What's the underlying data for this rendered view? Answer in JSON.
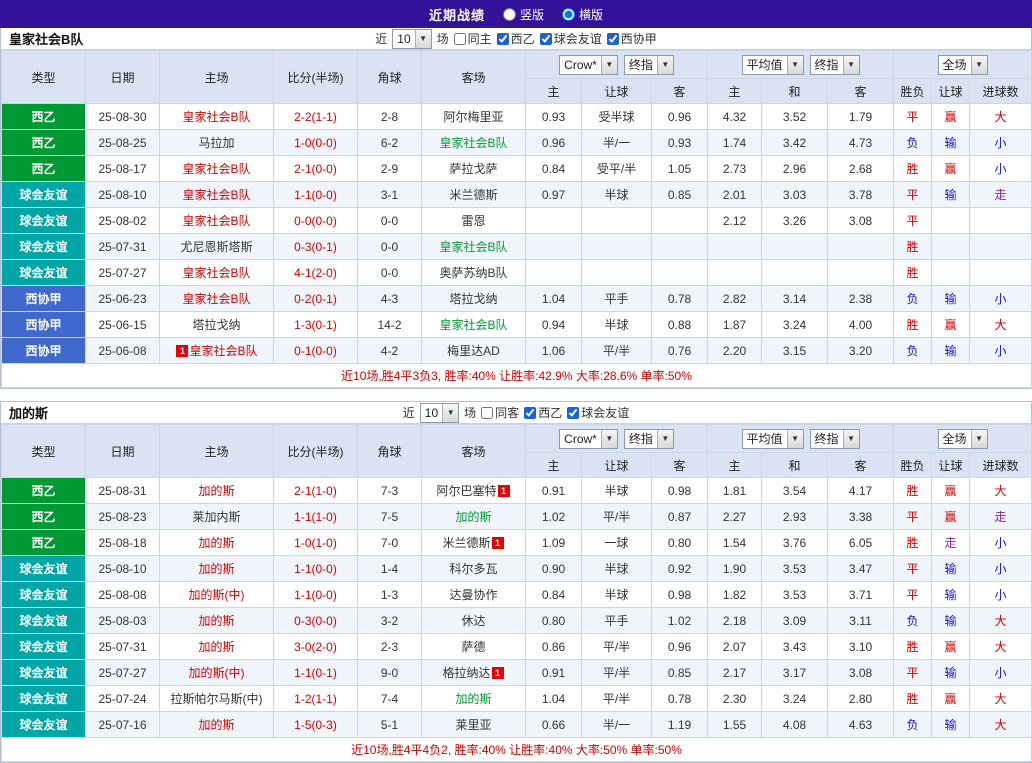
{
  "topbar": {
    "title": "近期战绩",
    "radio_vertical": "竖版",
    "radio_horizontal": "横版",
    "selected": "横版"
  },
  "colors": {
    "topbar_bg": "#341199",
    "header_bg": "#d9e3f3",
    "liga2_green": "#009933",
    "friendly_teal": "#00a6a6",
    "federation_blue": "#4169cd",
    "win_red": "#d40000",
    "lose_blue": "#1515cc",
    "push_purple": "#8822bb",
    "summary_red": "#d10000"
  },
  "table_headers": {
    "type": "类型",
    "date": "日期",
    "home": "主场",
    "score": "比分(半场)",
    "corner": "角球",
    "away": "客场",
    "asian_sub": [
      "主",
      "让球",
      "客"
    ],
    "euro_sub": [
      "主",
      "和",
      "客"
    ],
    "result_sub": [
      "胜负",
      "让球",
      "进球数"
    ]
  },
  "tables": [
    {
      "team": "皇家社会B队",
      "filters": {
        "near": "近",
        "count": "10",
        "games": "场",
        "checkboxes": [
          {
            "label": "同主",
            "checked": false
          },
          {
            "label": "西乙",
            "checked": true
          },
          {
            "label": "球会友谊",
            "checked": true
          },
          {
            "label": "西协甲",
            "checked": true
          }
        ]
      },
      "dropdowns": {
        "company": "Crow*",
        "company_stage": "终指",
        "euro": "平均值",
        "euro_stage": "终指",
        "scope": "全场"
      },
      "rows": [
        {
          "league": "西乙",
          "league_type": "liga2",
          "date": "25-08-30",
          "home": {
            "name": "皇家社会B队",
            "color": "red"
          },
          "score": "2-2(1-1)",
          "corner": "2-8",
          "away": {
            "name": "阿尔梅里亚",
            "color": "black"
          },
          "odds": [
            "0.93",
            "受半球",
            "0.96"
          ],
          "euro": [
            "4.32",
            "3.52",
            "1.79"
          ],
          "res": [
            [
              "平",
              "red"
            ],
            [
              "赢",
              "red"
            ],
            [
              "大",
              "red"
            ]
          ]
        },
        {
          "league": "西乙",
          "league_type": "liga2",
          "date": "25-08-25",
          "home": {
            "name": "马拉加",
            "color": "black"
          },
          "score": "1-0(0-0)",
          "corner": "6-2",
          "away": {
            "name": "皇家社会B队",
            "color": "green"
          },
          "odds": [
            "0.96",
            "半/一",
            "0.93"
          ],
          "euro": [
            "1.74",
            "3.42",
            "4.73"
          ],
          "res": [
            [
              "负",
              "blue"
            ],
            [
              "输",
              "blue"
            ],
            [
              "小",
              "blue"
            ]
          ]
        },
        {
          "league": "西乙",
          "league_type": "liga2",
          "date": "25-08-17",
          "home": {
            "name": "皇家社会B队",
            "color": "red"
          },
          "score": "2-1(0-0)",
          "corner": "2-9",
          "away": {
            "name": "萨拉戈萨",
            "color": "black"
          },
          "odds": [
            "0.84",
            "受平/半",
            "1.05"
          ],
          "euro": [
            "2.73",
            "2.96",
            "2.68"
          ],
          "res": [
            [
              "胜",
              "red"
            ],
            [
              "赢",
              "red"
            ],
            [
              "小",
              "blue"
            ]
          ]
        },
        {
          "league": "球会友谊",
          "league_type": "friendly",
          "date": "25-08-10",
          "home": {
            "name": "皇家社会B队",
            "color": "red"
          },
          "score": "1-1(0-0)",
          "corner": "3-1",
          "away": {
            "name": "米兰德斯",
            "color": "black"
          },
          "odds": [
            "0.97",
            "半球",
            "0.85"
          ],
          "euro": [
            "2.01",
            "3.03",
            "3.78"
          ],
          "res": [
            [
              "平",
              "red"
            ],
            [
              "输",
              "blue"
            ],
            [
              "走",
              "purple"
            ]
          ]
        },
        {
          "league": "球会友谊",
          "league_type": "friendly",
          "date": "25-08-02",
          "home": {
            "name": "皇家社会B队",
            "color": "red"
          },
          "score": "0-0(0-0)",
          "corner": "0-0",
          "away": {
            "name": "雷恩",
            "color": "black"
          },
          "odds": [
            "",
            "",
            ""
          ],
          "euro": [
            "2.12",
            "3.26",
            "3.08"
          ],
          "res": [
            [
              "平",
              "red"
            ],
            [
              "",
              ""
            ],
            [
              "",
              ""
            ]
          ]
        },
        {
          "league": "球会友谊",
          "league_type": "friendly",
          "date": "25-07-31",
          "home": {
            "name": "尤尼恩斯塔斯",
            "color": "black"
          },
          "score": "0-3(0-1)",
          "corner": "0-0",
          "away": {
            "name": "皇家社会B队",
            "color": "green"
          },
          "odds": [
            "",
            "",
            ""
          ],
          "euro": [
            "",
            "",
            ""
          ],
          "res": [
            [
              "胜",
              "red"
            ],
            [
              "",
              ""
            ],
            [
              "",
              ""
            ]
          ]
        },
        {
          "league": "球会友谊",
          "league_type": "friendly",
          "date": "25-07-27",
          "home": {
            "name": "皇家社会B队",
            "color": "red"
          },
          "score": "4-1(2-0)",
          "corner": "0-0",
          "away": {
            "name": "奥萨苏纳B队",
            "color": "black"
          },
          "odds": [
            "",
            "",
            ""
          ],
          "euro": [
            "",
            "",
            ""
          ],
          "res": [
            [
              "胜",
              "red"
            ],
            [
              "",
              ""
            ],
            [
              "",
              ""
            ]
          ]
        },
        {
          "league": "西协甲",
          "league_type": "fed",
          "date": "25-06-23",
          "home": {
            "name": "皇家社会B队",
            "color": "red"
          },
          "score": "0-2(0-1)",
          "corner": "4-3",
          "away": {
            "name": "塔拉戈纳",
            "color": "black"
          },
          "odds": [
            "1.04",
            "平手",
            "0.78"
          ],
          "euro": [
            "2.82",
            "3.14",
            "2.38"
          ],
          "res": [
            [
              "负",
              "blue"
            ],
            [
              "输",
              "blue"
            ],
            [
              "小",
              "blue"
            ]
          ]
        },
        {
          "league": "西协甲",
          "league_type": "fed",
          "date": "25-06-15",
          "home": {
            "name": "塔拉戈纳",
            "color": "black"
          },
          "score": "1-3(0-1)",
          "corner": "14-2",
          "away": {
            "name": "皇家社会B队",
            "color": "green"
          },
          "odds": [
            "0.94",
            "半球",
            "0.88"
          ],
          "euro": [
            "1.87",
            "3.24",
            "4.00"
          ],
          "res": [
            [
              "胜",
              "red"
            ],
            [
              "赢",
              "red"
            ],
            [
              "大",
              "red"
            ]
          ]
        },
        {
          "league": "西协甲",
          "league_type": "fed",
          "date": "25-06-08",
          "home": {
            "name": "皇家社会B队",
            "color": "red",
            "badge": "1",
            "badge_pos": "before"
          },
          "score": "0-1(0-0)",
          "corner": "4-2",
          "away": {
            "name": "梅里达AD",
            "color": "black"
          },
          "odds": [
            "1.06",
            "平/半",
            "0.76"
          ],
          "euro": [
            "2.20",
            "3.15",
            "3.20"
          ],
          "res": [
            [
              "负",
              "blue"
            ],
            [
              "输",
              "blue"
            ],
            [
              "小",
              "blue"
            ]
          ]
        }
      ],
      "summary": "近10场,胜4平3负3, 胜率:40% 让胜率:42.9% 大率:28.6% 单率:50%"
    },
    {
      "team": "加的斯",
      "filters": {
        "near": "近",
        "count": "10",
        "games": "场",
        "checkboxes": [
          {
            "label": "同客",
            "checked": false
          },
          {
            "label": "西乙",
            "checked": true
          },
          {
            "label": "球会友谊",
            "checked": true
          }
        ]
      },
      "dropdowns": {
        "company": "Crow*",
        "company_stage": "终指",
        "euro": "平均值",
        "euro_stage": "终指",
        "scope": "全场"
      },
      "rows": [
        {
          "league": "西乙",
          "league_type": "liga2",
          "date": "25-08-31",
          "home": {
            "name": "加的斯",
            "color": "red"
          },
          "score": "2-1(1-0)",
          "corner": "7-3",
          "away": {
            "name": "阿尔巴塞特",
            "color": "black",
            "badge": "1",
            "badge_pos": "after"
          },
          "odds": [
            "0.91",
            "半球",
            "0.98"
          ],
          "euro": [
            "1.81",
            "3.54",
            "4.17"
          ],
          "res": [
            [
              "胜",
              "red"
            ],
            [
              "赢",
              "red"
            ],
            [
              "大",
              "red"
            ]
          ]
        },
        {
          "league": "西乙",
          "league_type": "liga2",
          "date": "25-08-23",
          "home": {
            "name": "莱加内斯",
            "color": "black"
          },
          "score": "1-1(1-0)",
          "corner": "7-5",
          "away": {
            "name": "加的斯",
            "color": "green"
          },
          "odds": [
            "1.02",
            "平/半",
            "0.87"
          ],
          "euro": [
            "2.27",
            "2.93",
            "3.38"
          ],
          "res": [
            [
              "平",
              "red"
            ],
            [
              "赢",
              "red"
            ],
            [
              "走",
              "purple"
            ]
          ]
        },
        {
          "league": "西乙",
          "league_type": "liga2",
          "date": "25-08-18",
          "home": {
            "name": "加的斯",
            "color": "red"
          },
          "score": "1-0(1-0)",
          "corner": "7-0",
          "away": {
            "name": "米兰德斯",
            "color": "black",
            "badge": "1",
            "badge_pos": "after"
          },
          "odds": [
            "1.09",
            "一球",
            "0.80"
          ],
          "euro": [
            "1.54",
            "3.76",
            "6.05"
          ],
          "res": [
            [
              "胜",
              "red"
            ],
            [
              "走",
              "purple"
            ],
            [
              "小",
              "blue"
            ]
          ]
        },
        {
          "league": "球会友谊",
          "league_type": "friendly",
          "date": "25-08-10",
          "home": {
            "name": "加的斯",
            "color": "red"
          },
          "score": "1-1(0-0)",
          "corner": "1-4",
          "away": {
            "name": "科尔多瓦",
            "color": "black"
          },
          "odds": [
            "0.90",
            "半球",
            "0.92"
          ],
          "euro": [
            "1.90",
            "3.53",
            "3.47"
          ],
          "res": [
            [
              "平",
              "red"
            ],
            [
              "输",
              "blue"
            ],
            [
              "小",
              "blue"
            ]
          ]
        },
        {
          "league": "球会友谊",
          "league_type": "friendly",
          "date": "25-08-08",
          "home": {
            "name": "加的斯(中)",
            "color": "red"
          },
          "score": "1-1(0-0)",
          "corner": "1-3",
          "away": {
            "name": "达曼协作",
            "color": "black"
          },
          "odds": [
            "0.84",
            "半球",
            "0.98"
          ],
          "euro": [
            "1.82",
            "3.53",
            "3.71"
          ],
          "res": [
            [
              "平",
              "red"
            ],
            [
              "输",
              "blue"
            ],
            [
              "小",
              "blue"
            ]
          ]
        },
        {
          "league": "球会友谊",
          "league_type": "friendly",
          "date": "25-08-03",
          "home": {
            "name": "加的斯",
            "color": "red"
          },
          "score": "0-3(0-0)",
          "corner": "3-2",
          "away": {
            "name": "休达",
            "color": "black"
          },
          "odds": [
            "0.80",
            "平手",
            "1.02"
          ],
          "euro": [
            "2.18",
            "3.09",
            "3.11"
          ],
          "res": [
            [
              "负",
              "blue"
            ],
            [
              "输",
              "blue"
            ],
            [
              "大",
              "red"
            ]
          ]
        },
        {
          "league": "球会友谊",
          "league_type": "friendly",
          "date": "25-07-31",
          "home": {
            "name": "加的斯",
            "color": "red"
          },
          "score": "3-0(2-0)",
          "corner": "2-3",
          "away": {
            "name": "萨德",
            "color": "black"
          },
          "odds": [
            "0.86",
            "平/半",
            "0.96"
          ],
          "euro": [
            "2.07",
            "3.43",
            "3.10"
          ],
          "res": [
            [
              "胜",
              "red"
            ],
            [
              "赢",
              "red"
            ],
            [
              "大",
              "red"
            ]
          ]
        },
        {
          "league": "球会友谊",
          "league_type": "friendly",
          "date": "25-07-27",
          "home": {
            "name": "加的斯(中)",
            "color": "red"
          },
          "score": "1-1(0-1)",
          "corner": "9-0",
          "away": {
            "name": "格拉纳达",
            "color": "black",
            "badge": "1",
            "badge_pos": "after"
          },
          "odds": [
            "0.91",
            "平/半",
            "0.85"
          ],
          "euro": [
            "2.17",
            "3.17",
            "3.08"
          ],
          "res": [
            [
              "平",
              "red"
            ],
            [
              "输",
              "blue"
            ],
            [
              "小",
              "blue"
            ]
          ]
        },
        {
          "league": "球会友谊",
          "league_type": "friendly",
          "date": "25-07-24",
          "home": {
            "name": "拉斯帕尔马斯(中)",
            "color": "black"
          },
          "score": "1-2(1-1)",
          "corner": "7-4",
          "away": {
            "name": "加的斯",
            "color": "green"
          },
          "odds": [
            "1.04",
            "平/半",
            "0.78"
          ],
          "euro": [
            "2.30",
            "3.24",
            "2.80"
          ],
          "res": [
            [
              "胜",
              "red"
            ],
            [
              "赢",
              "red"
            ],
            [
              "大",
              "red"
            ]
          ]
        },
        {
          "league": "球会友谊",
          "league_type": "friendly",
          "date": "25-07-16",
          "home": {
            "name": "加的斯",
            "color": "red"
          },
          "score": "1-5(0-3)",
          "corner": "5-1",
          "away": {
            "name": "莱里亚",
            "color": "black"
          },
          "odds": [
            "0.66",
            "半/一",
            "1.19"
          ],
          "euro": [
            "1.55",
            "4.08",
            "4.63"
          ],
          "res": [
            [
              "负",
              "blue"
            ],
            [
              "输",
              "blue"
            ],
            [
              "大",
              "red"
            ]
          ]
        }
      ],
      "summary": "近10场,胜4平4负2, 胜率:40% 让胜率:40% 大率:50% 单率:50%"
    }
  ]
}
